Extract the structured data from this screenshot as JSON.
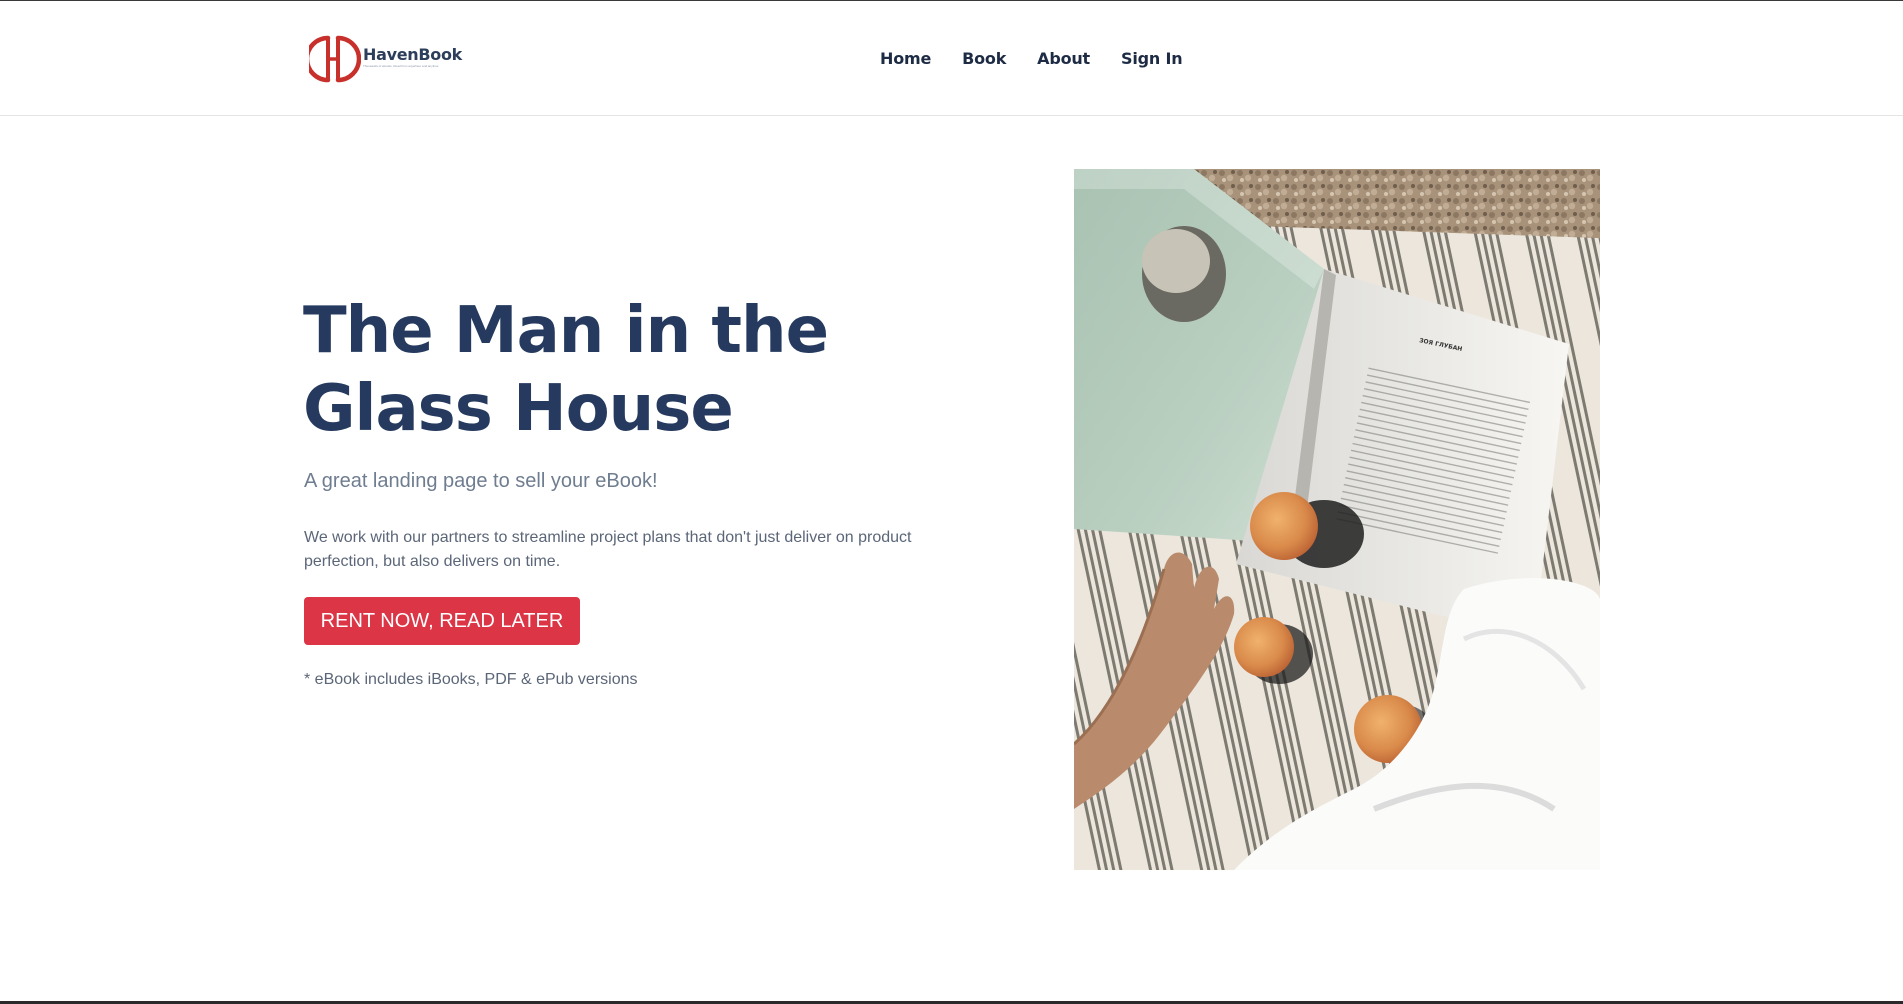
{
  "brand": {
    "name": "HavenBook",
    "tagline": "Thousands of ebooks, Read from anywhere and anytime",
    "logo_color": "#c8302b"
  },
  "nav": {
    "items": [
      "Home",
      "Book",
      "About",
      "Sign In"
    ]
  },
  "hero": {
    "title": "The Man in the Glass House",
    "subtitle": "A great landing page to sell your eBook!",
    "description": "We work with our partners to streamline project plans that don't just deliver on product perfection, but also delivers on time.",
    "cta_label": "RENT NOW, READ LATER",
    "note": "* eBook includes iBooks, PDF & ePub versions",
    "image_page_heading": "ЗОЯ ГЛУБАН"
  },
  "colors": {
    "title": "#253a5e",
    "cta": "#dc3545",
    "nav_text": "#1d2b44",
    "body_text": "#5b6678"
  }
}
